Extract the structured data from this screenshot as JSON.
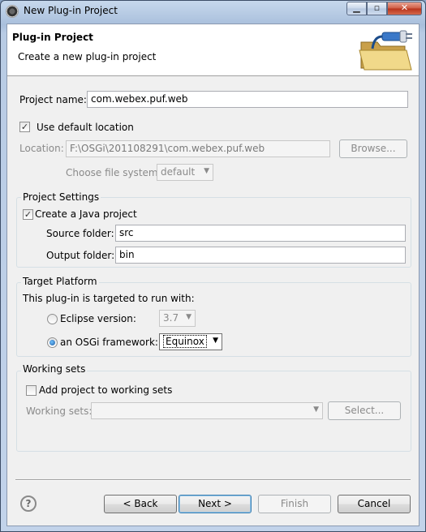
{
  "window": {
    "title": "New Plug-in Project",
    "min_glyph": "▁",
    "max_glyph": "▫",
    "close_glyph": "✕"
  },
  "banner": {
    "title": "Plug-in Project",
    "description": "Create a new plug-in project"
  },
  "project_name": {
    "label": "Project name:",
    "value": "com.webex.puf.web"
  },
  "default_location": {
    "label": "Use default location",
    "checked": true
  },
  "location": {
    "label": "Location:",
    "value": "F:\\OSGi\\201108291\\com.webex.puf.web",
    "browse_label": "Browse..."
  },
  "file_system": {
    "label": "Choose file system:",
    "value": "default"
  },
  "project_settings": {
    "title": "Project Settings",
    "java_project_label": "Create a Java project",
    "java_project_checked": true,
    "source_label": "Source folder:",
    "source_value": "src",
    "output_label": "Output folder:",
    "output_value": "bin"
  },
  "target_platform": {
    "title": "Target Platform",
    "description": "This plug-in is targeted to run with:",
    "eclipse_label": "Eclipse version:",
    "eclipse_value": "3.7",
    "osgi_label": "an OSGi framework:",
    "osgi_value": "Equinox",
    "selected": "osgi"
  },
  "working_sets": {
    "title": "Working sets",
    "add_label": "Add project to working sets",
    "add_checked": false,
    "sets_label": "Working sets:",
    "sets_value": "",
    "select_label": "Select..."
  },
  "footer": {
    "help_glyph": "?",
    "back_label": "< Back",
    "next_label": "Next >",
    "finish_label": "Finish",
    "cancel_label": "Cancel"
  },
  "icons": {
    "check_glyph": "✓",
    "dropdown_glyph": "▼"
  }
}
